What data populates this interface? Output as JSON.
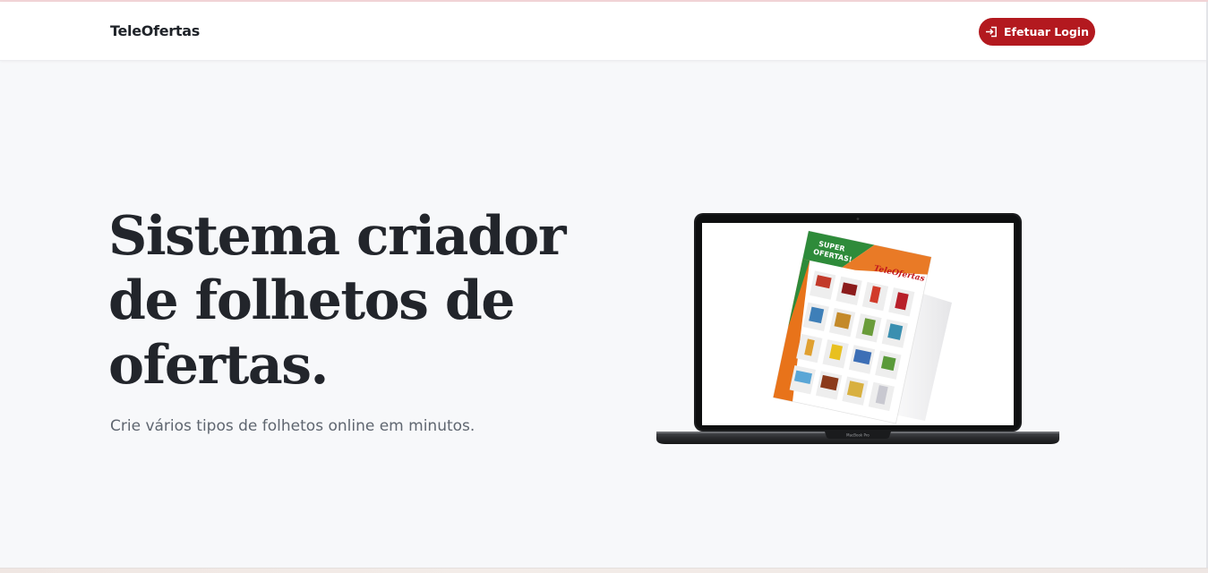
{
  "header": {
    "brand": "TeleOfertas",
    "login_label": "Efetuar Login",
    "login_icon": "login-arrow-icon"
  },
  "hero": {
    "title_lines": [
      "Sistema criador",
      "de folhetos de",
      "ofertas."
    ],
    "subtitle": "Crie vários tipos de folhetos online em minutos."
  },
  "illustration": {
    "device_label": "MacBook Pro",
    "flyer_banner_line1": "SUPER",
    "flyer_banner_line2": "OFERTAS!",
    "flyer_logo": "TeleOfertas"
  },
  "colors": {
    "accent": "#b3191f",
    "background": "#f7f8fa",
    "heading": "#22252b",
    "flyer_green": "#2e8b3a",
    "flyer_orange": "#e8731a"
  }
}
